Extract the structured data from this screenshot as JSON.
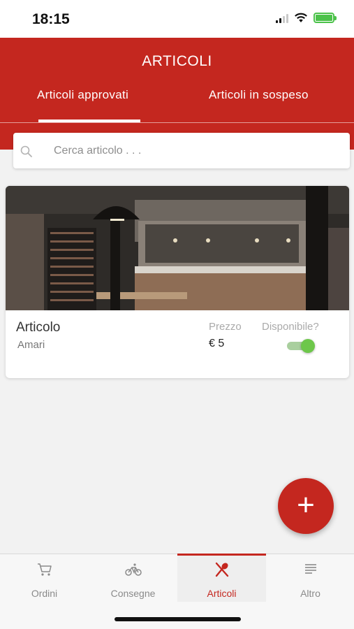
{
  "status_bar": {
    "time": "18:15"
  },
  "header": {
    "title": "ARTICOLI",
    "tabs": [
      {
        "label": "Articoli approvati",
        "active": true
      },
      {
        "label": "Articoli in sospeso",
        "active": false
      }
    ]
  },
  "search": {
    "placeholder": "Cerca articolo . . ."
  },
  "items": [
    {
      "name": "Articolo",
      "category": "Amari",
      "price_label": "Prezzo",
      "price": "€ 5",
      "available_label": "Disponibile?",
      "available": true
    }
  ],
  "fab": {
    "symbol": "+"
  },
  "tabbar": {
    "items": [
      {
        "label": "Ordini",
        "icon": "cart-icon",
        "active": false
      },
      {
        "label": "Consegne",
        "icon": "bicycle-icon",
        "active": false
      },
      {
        "label": "Articoli",
        "icon": "utensils-icon",
        "active": true
      },
      {
        "label": "Altro",
        "icon": "menu-lines-icon",
        "active": false
      }
    ]
  },
  "colors": {
    "brand": "#c4271f",
    "toggle_on": "#6dc74a",
    "battery": "#4cc24a"
  }
}
